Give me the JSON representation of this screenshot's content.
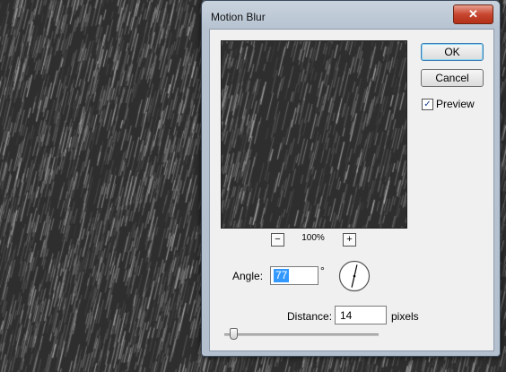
{
  "dialog": {
    "title": "Motion Blur",
    "close_label": "✕",
    "ok_label": "OK",
    "cancel_label": "Cancel",
    "preview": {
      "label": "Preview",
      "checked": true,
      "check_mark": "✓"
    },
    "zoom": {
      "minus_label": "−",
      "plus_label": "+",
      "level": "100%"
    },
    "angle": {
      "label": "Angle:",
      "value": "77",
      "unit": "°",
      "degrees": 77
    },
    "distance": {
      "label": "Distance:",
      "value": "14",
      "unit": "pixels",
      "slider_fraction": 0.05
    }
  },
  "colors": {
    "texture_dark": "#2e2e2e",
    "streak": "#9a9a9a",
    "selection": "#3399ff",
    "close_red": "#c7462f"
  }
}
